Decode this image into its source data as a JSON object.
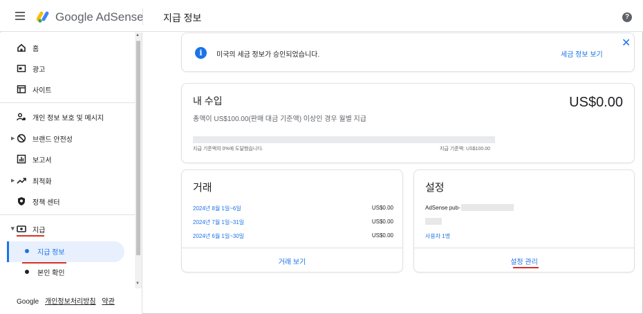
{
  "header": {
    "brand": "Google AdSense",
    "page_title": "지급 정보",
    "help_glyph": "?"
  },
  "colors": {
    "accent": "#1a73e8",
    "annotation_red": "#d93025",
    "active_bg": "#e8f0fe"
  },
  "sidebar": {
    "items": [
      {
        "label": "홈",
        "icon": "home-icon"
      },
      {
        "label": "광고",
        "icon": "ads-icon"
      },
      {
        "label": "사이트",
        "icon": "sites-icon"
      },
      {
        "label": "개인 정보 보호 및 메시지",
        "icon": "privacy-messaging-icon"
      },
      {
        "label": "브랜드 안전성",
        "icon": "block-icon"
      },
      {
        "label": "보고서",
        "icon": "reports-icon"
      },
      {
        "label": "최적화",
        "icon": "trending-icon"
      },
      {
        "label": "정책 센터",
        "icon": "policy-shield-icon"
      },
      {
        "label": "지급",
        "icon": "payments-icon"
      },
      {
        "label": "지급 정보",
        "icon": "bullet-icon"
      },
      {
        "label": "본인 확인",
        "icon": "bullet-icon"
      }
    ],
    "footer": {
      "google": "Google",
      "privacy": "개인정보처리방침",
      "terms": "약관"
    }
  },
  "notice": {
    "text": "미국의 세금 정보가 승인되었습니다.",
    "link": "세금 정보 보기",
    "info_glyph": "i",
    "close_glyph": "✕"
  },
  "earnings": {
    "title": "내 수입",
    "amount": "US$0.00",
    "subtitle": "총액이 US$100.00(판매 대금 기준액) 이상인 경우 월별 지급",
    "progress_fraction": 0,
    "progress_left": "지급 기준액의 0%에 도달했습니다.",
    "progress_right": "지급 기준액: US$100.00"
  },
  "transactions": {
    "title": "거래",
    "rows": [
      {
        "date": "2024년 8월 1일~6일",
        "amount": "US$0.00"
      },
      {
        "date": "2024년 7월 1일~31일",
        "amount": "US$0.00"
      },
      {
        "date": "2024년 6월 1일~30일",
        "amount": "US$0.00"
      }
    ],
    "footer_link": "거래 보기"
  },
  "settings": {
    "title": "설정",
    "pub_label": "AdSense pub-",
    "users_link": "사용자 1명",
    "footer_link": "설정 관리"
  }
}
